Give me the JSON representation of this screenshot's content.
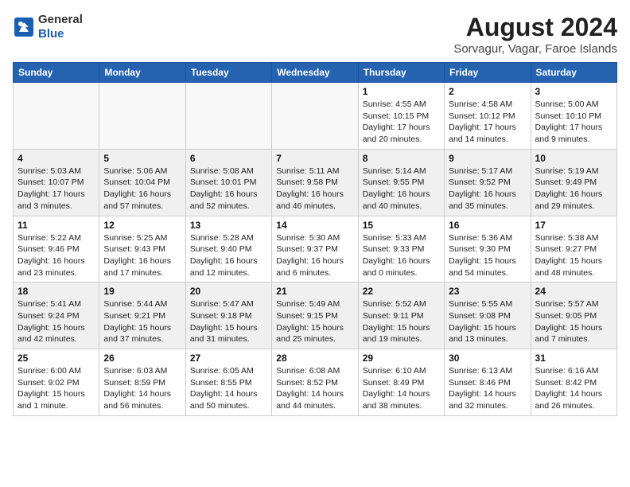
{
  "header": {
    "logo_line1": "General",
    "logo_line2": "Blue",
    "month_year": "August 2024",
    "location": "Sorvagur, Vagar, Faroe Islands"
  },
  "weekdays": [
    "Sunday",
    "Monday",
    "Tuesday",
    "Wednesday",
    "Thursday",
    "Friday",
    "Saturday"
  ],
  "weeks": [
    [
      {
        "day": "",
        "empty": true
      },
      {
        "day": "",
        "empty": true
      },
      {
        "day": "",
        "empty": true
      },
      {
        "day": "",
        "empty": true
      },
      {
        "day": "1",
        "sunrise": "4:55 AM",
        "sunset": "10:15 PM",
        "daylight": "17 hours and 20 minutes."
      },
      {
        "day": "2",
        "sunrise": "4:58 AM",
        "sunset": "10:12 PM",
        "daylight": "17 hours and 14 minutes."
      },
      {
        "day": "3",
        "sunrise": "5:00 AM",
        "sunset": "10:10 PM",
        "daylight": "17 hours and 9 minutes."
      }
    ],
    [
      {
        "day": "4",
        "sunrise": "5:03 AM",
        "sunset": "10:07 PM",
        "daylight": "17 hours and 3 minutes."
      },
      {
        "day": "5",
        "sunrise": "5:06 AM",
        "sunset": "10:04 PM",
        "daylight": "16 hours and 57 minutes."
      },
      {
        "day": "6",
        "sunrise": "5:08 AM",
        "sunset": "10:01 PM",
        "daylight": "16 hours and 52 minutes."
      },
      {
        "day": "7",
        "sunrise": "5:11 AM",
        "sunset": "9:58 PM",
        "daylight": "16 hours and 46 minutes."
      },
      {
        "day": "8",
        "sunrise": "5:14 AM",
        "sunset": "9:55 PM",
        "daylight": "16 hours and 40 minutes."
      },
      {
        "day": "9",
        "sunrise": "5:17 AM",
        "sunset": "9:52 PM",
        "daylight": "16 hours and 35 minutes."
      },
      {
        "day": "10",
        "sunrise": "5:19 AM",
        "sunset": "9:49 PM",
        "daylight": "16 hours and 29 minutes."
      }
    ],
    [
      {
        "day": "11",
        "sunrise": "5:22 AM",
        "sunset": "9:46 PM",
        "daylight": "16 hours and 23 minutes."
      },
      {
        "day": "12",
        "sunrise": "5:25 AM",
        "sunset": "9:43 PM",
        "daylight": "16 hours and 17 minutes."
      },
      {
        "day": "13",
        "sunrise": "5:28 AM",
        "sunset": "9:40 PM",
        "daylight": "16 hours and 12 minutes."
      },
      {
        "day": "14",
        "sunrise": "5:30 AM",
        "sunset": "9:37 PM",
        "daylight": "16 hours and 6 minutes."
      },
      {
        "day": "15",
        "sunrise": "5:33 AM",
        "sunset": "9:33 PM",
        "daylight": "16 hours and 0 minutes."
      },
      {
        "day": "16",
        "sunrise": "5:36 AM",
        "sunset": "9:30 PM",
        "daylight": "15 hours and 54 minutes."
      },
      {
        "day": "17",
        "sunrise": "5:38 AM",
        "sunset": "9:27 PM",
        "daylight": "15 hours and 48 minutes."
      }
    ],
    [
      {
        "day": "18",
        "sunrise": "5:41 AM",
        "sunset": "9:24 PM",
        "daylight": "15 hours and 42 minutes."
      },
      {
        "day": "19",
        "sunrise": "5:44 AM",
        "sunset": "9:21 PM",
        "daylight": "15 hours and 37 minutes."
      },
      {
        "day": "20",
        "sunrise": "5:47 AM",
        "sunset": "9:18 PM",
        "daylight": "15 hours and 31 minutes."
      },
      {
        "day": "21",
        "sunrise": "5:49 AM",
        "sunset": "9:15 PM",
        "daylight": "15 hours and 25 minutes."
      },
      {
        "day": "22",
        "sunrise": "5:52 AM",
        "sunset": "9:11 PM",
        "daylight": "15 hours and 19 minutes."
      },
      {
        "day": "23",
        "sunrise": "5:55 AM",
        "sunset": "9:08 PM",
        "daylight": "15 hours and 13 minutes."
      },
      {
        "day": "24",
        "sunrise": "5:57 AM",
        "sunset": "9:05 PM",
        "daylight": "15 hours and 7 minutes."
      }
    ],
    [
      {
        "day": "25",
        "sunrise": "6:00 AM",
        "sunset": "9:02 PM",
        "daylight": "15 hours and 1 minute."
      },
      {
        "day": "26",
        "sunrise": "6:03 AM",
        "sunset": "8:59 PM",
        "daylight": "14 hours and 56 minutes."
      },
      {
        "day": "27",
        "sunrise": "6:05 AM",
        "sunset": "8:55 PM",
        "daylight": "14 hours and 50 minutes."
      },
      {
        "day": "28",
        "sunrise": "6:08 AM",
        "sunset": "8:52 PM",
        "daylight": "14 hours and 44 minutes."
      },
      {
        "day": "29",
        "sunrise": "6:10 AM",
        "sunset": "8:49 PM",
        "daylight": "14 hours and 38 minutes."
      },
      {
        "day": "30",
        "sunrise": "6:13 AM",
        "sunset": "8:46 PM",
        "daylight": "14 hours and 32 minutes."
      },
      {
        "day": "31",
        "sunrise": "6:16 AM",
        "sunset": "8:42 PM",
        "daylight": "14 hours and 26 minutes."
      }
    ]
  ]
}
